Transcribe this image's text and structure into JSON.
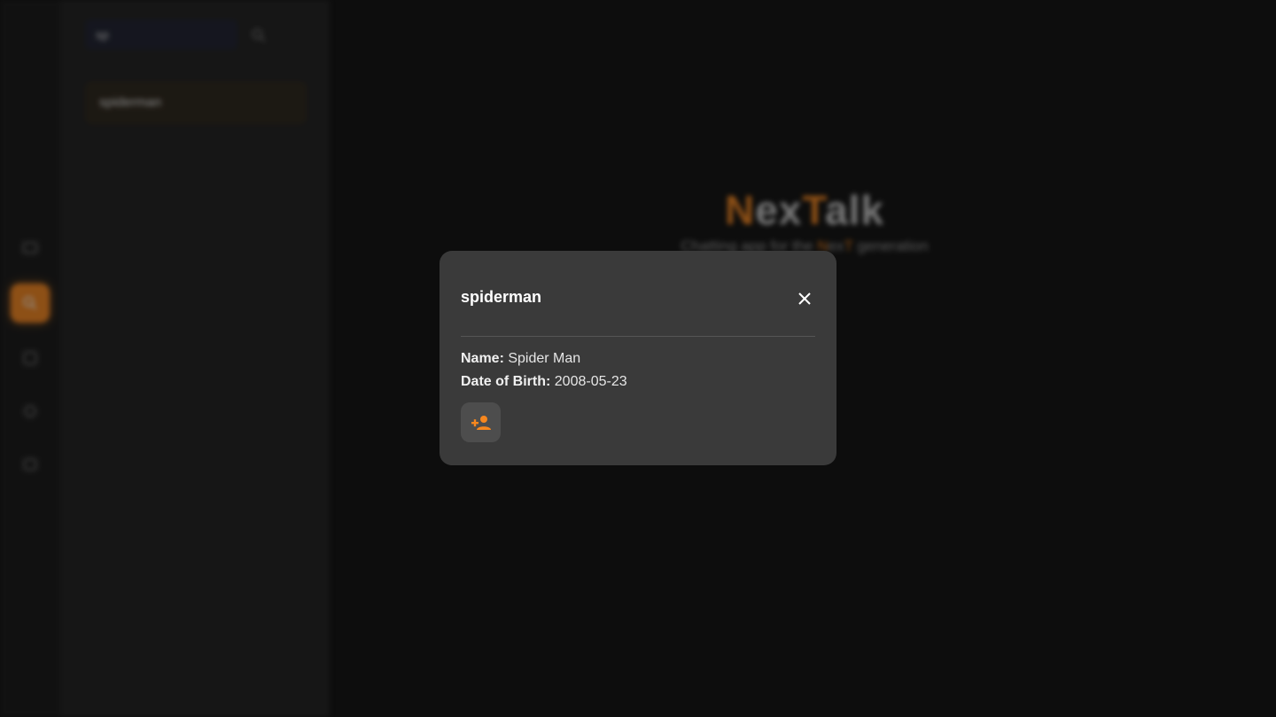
{
  "sidebar": {
    "search_value": "sp",
    "results": [
      {
        "username": "spiderman"
      }
    ]
  },
  "nav_icons": [
    "chat-icon",
    "search-icon",
    "contacts-icon",
    "settings-icon",
    "profile-icon"
  ],
  "brand": {
    "title_part1": "N",
    "title_part2": "ex",
    "title_part3": "T",
    "title_part4": "alk",
    "tagline_part1": "Chatting app for the ",
    "tagline_part2": "N",
    "tagline_part3": "ex",
    "tagline_part4": "T",
    "tagline_part5": " generation"
  },
  "modal": {
    "username": "spiderman",
    "name_label": "Name:",
    "name_value": "Spider Man",
    "dob_label": "Date of Birth:",
    "dob_value": "2008-05-23",
    "add_icon": "add-person-icon",
    "close_icon": "close-icon"
  },
  "colors": {
    "accent": "#f7871e",
    "modal_bg": "#3a3a3a",
    "page_bg": "#0d0d0d"
  }
}
